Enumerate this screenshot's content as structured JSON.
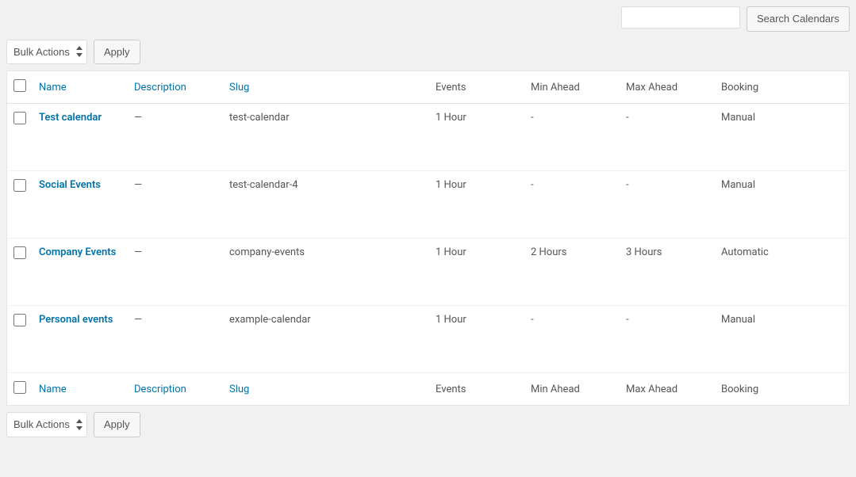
{
  "search": {
    "placeholder": "",
    "button_label": "Search Calendars"
  },
  "bulk_actions": {
    "selected_label": "Bulk Actions",
    "apply_label": "Apply"
  },
  "columns": {
    "name": "Name",
    "description": "Description",
    "slug": "Slug",
    "events": "Events",
    "min_ahead": "Min Ahead",
    "max_ahead": "Max Ahead",
    "booking": "Booking"
  },
  "rows": [
    {
      "name": "Test calendar",
      "description": "—",
      "slug": "test-calendar",
      "events": "1 Hour",
      "min_ahead": "-",
      "max_ahead": "-",
      "booking": "Manual"
    },
    {
      "name": "Social Events",
      "description": "—",
      "slug": "test-calendar-4",
      "events": "1 Hour",
      "min_ahead": "-",
      "max_ahead": "-",
      "booking": "Manual"
    },
    {
      "name": "Company Events",
      "description": "—",
      "slug": "company-events",
      "events": "1 Hour",
      "min_ahead": "2 Hours",
      "max_ahead": "3 Hours",
      "booking": "Automatic"
    },
    {
      "name": "Personal events",
      "description": "—",
      "slug": "example-calendar",
      "events": "1 Hour",
      "min_ahead": "-",
      "max_ahead": "-",
      "booking": "Manual"
    }
  ]
}
